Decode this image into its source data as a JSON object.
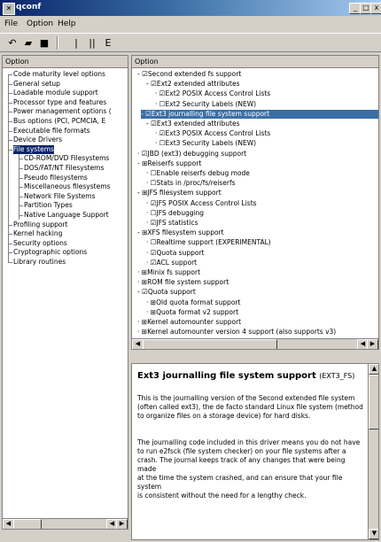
{
  "window": {
    "title": "qconf"
  },
  "menu": [
    "File",
    "Option",
    "Help"
  ],
  "left_panel": {
    "header": "Option",
    "items": [
      {
        "label": "Code maturity level options",
        "level": 0
      },
      {
        "label": "General setup",
        "level": 0
      },
      {
        "label": "Loadable module support",
        "level": 0
      },
      {
        "label": "Processor type and features",
        "level": 0
      },
      {
        "label": "Power management options (",
        "level": 0
      },
      {
        "label": "Bus options (PCI, PCMCIA, E",
        "level": 0
      },
      {
        "label": "Executable file formats",
        "level": 0
      },
      {
        "label": "Device Drivers",
        "level": 0
      },
      {
        "label": "File systems",
        "level": 0,
        "selected": true
      },
      {
        "label": "CD-ROM/DVD Filesystems",
        "level": 1
      },
      {
        "label": "DOS/FAT/NT Filesystems",
        "level": 1
      },
      {
        "label": "Pseudo filesystems",
        "level": 1
      },
      {
        "label": "Miscellaneous filesystems",
        "level": 1
      },
      {
        "label": "Network File Systems",
        "level": 1
      },
      {
        "label": "Partition Types",
        "level": 1
      },
      {
        "label": "Native Language Support",
        "level": 1
      },
      {
        "label": "Profiling support",
        "level": 0
      },
      {
        "label": "Kernel hacking",
        "level": 0
      },
      {
        "label": "Security options",
        "level": 0
      },
      {
        "label": "Cryptographic options",
        "level": 0
      },
      {
        "label": "Library routines",
        "level": 0
      }
    ]
  },
  "right_panel": {
    "header": "Option",
    "items": [
      {
        "label": "Second extended fs support",
        "level": 0,
        "expander": "-",
        "check": "☑"
      },
      {
        "label": "Ext2 extended attributes",
        "level": 1,
        "expander": "-",
        "check": "☑"
      },
      {
        "label": "Ext2 POSIX Access Control Lists",
        "level": 2,
        "expander": "",
        "check": "☑"
      },
      {
        "label": "Ext2 Security Labels (NEW)",
        "level": 2,
        "expander": "",
        "check": "☐"
      },
      {
        "label": "Ext3 journalling file system support",
        "level": 0,
        "expander": "-",
        "check": "☑",
        "selected": true
      },
      {
        "label": "Ext3 extended attributes",
        "level": 1,
        "expander": "-",
        "check": "☑"
      },
      {
        "label": "Ext3 POSIX Access Control Lists",
        "level": 2,
        "expander": "",
        "check": "☑"
      },
      {
        "label": "Ext3 Security Labels (NEW)",
        "level": 2,
        "expander": "",
        "check": "☐"
      },
      {
        "label": "JBD (ext3) debugging support",
        "level": 0,
        "expander": "",
        "check": "☑"
      },
      {
        "label": "Reiserfs support",
        "level": 0,
        "expander": "-",
        "check": "⊞"
      },
      {
        "label": "Enable reiserfs debug mode",
        "level": 1,
        "expander": "",
        "check": "☐"
      },
      {
        "label": "Stats in /proc/fs/reiserfs",
        "level": 1,
        "expander": "",
        "check": "☐"
      },
      {
        "label": "JFS filesystem support",
        "level": 0,
        "expander": "-",
        "check": "⊞"
      },
      {
        "label": "JFS POSIX Access Control Lists",
        "level": 1,
        "expander": "",
        "check": "☑"
      },
      {
        "label": "JFS debugging",
        "level": 1,
        "expander": "",
        "check": "☐"
      },
      {
        "label": "JFS statistics",
        "level": 1,
        "expander": "",
        "check": "☑"
      },
      {
        "label": "XFS filesystem support",
        "level": 0,
        "expander": "-",
        "check": "⊞"
      },
      {
        "label": "Realtime support (EXPERIMENTAL)",
        "level": 1,
        "expander": "",
        "check": "☐"
      },
      {
        "label": "Quota support",
        "level": 1,
        "expander": "",
        "check": "☑"
      },
      {
        "label": "ACL support",
        "level": 1,
        "expander": "",
        "check": "☑"
      },
      {
        "label": "Minix fs support",
        "level": 0,
        "expander": "",
        "check": "⊞"
      },
      {
        "label": "ROM file system support",
        "level": 0,
        "expander": "",
        "check": "⊞"
      },
      {
        "label": "Quota support",
        "level": 0,
        "expander": "-",
        "check": "☑"
      },
      {
        "label": "Old quota format support",
        "level": 1,
        "expander": "",
        "check": "⊞"
      },
      {
        "label": "Quota format v2 support",
        "level": 1,
        "expander": "",
        "check": "⊞"
      },
      {
        "label": "Kernel automounter support",
        "level": 0,
        "expander": "",
        "check": "⊞"
      },
      {
        "label": "Kernel automounter version 4 support (also supports v3)",
        "level": 0,
        "expander": "",
        "check": "⊞"
      }
    ]
  },
  "help": {
    "title": "Ext3 journalling file system support",
    "symbol": "(EXT3_FS)",
    "para1": "This is the journalling version of the Second extended file system (often called ext3), the de facto standard Linux file system (method to organize files on a storage device) for hard disks.",
    "para2": "The journalling code included in this driver means you do not have to run e2fsck (file system checker) on your file systems after a crash. The journal keeps track of any changes that were being made",
    "para3": "at the time the system crashed, and can ensure that your file system",
    "para4": "is consistent without the need for a lengthy check."
  },
  "colors": {
    "selection": "#0a246a",
    "selection_right": "#3a6ea5",
    "title_gradient_start": "#0a246a"
  }
}
